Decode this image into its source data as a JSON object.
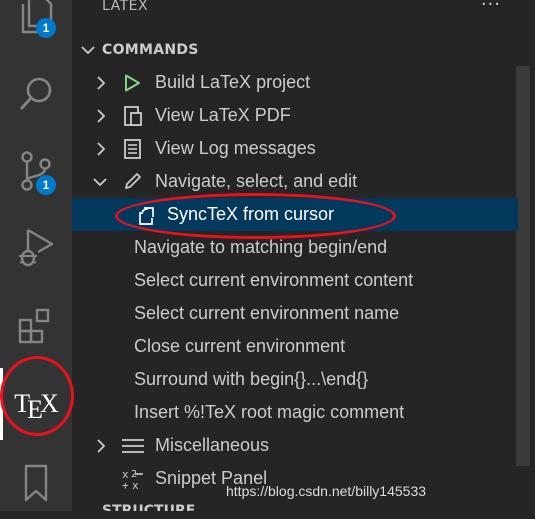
{
  "activity_bar": {
    "explorer_badge": "1",
    "source_control_badge": "1",
    "tex_logo_t": "T",
    "tex_logo_e": "E",
    "tex_logo_x": "X",
    "active_item": "tex"
  },
  "panel": {
    "title": "LATEX",
    "more_actions": "···",
    "section_title": "COMMANDS",
    "items": [
      {
        "label": "Build LaTeX project",
        "icon": "play-icon",
        "collapsed": true
      },
      {
        "label": "View LaTeX PDF",
        "icon": "pdf-preview-icon",
        "collapsed": true
      },
      {
        "label": "View Log messages",
        "icon": "log-icon",
        "collapsed": true
      },
      {
        "label": "Navigate, select, and edit",
        "icon": "edit-icon",
        "expanded": true
      },
      {
        "label": "SyncTeX from cursor",
        "icon": "sync-icon",
        "selected": true
      },
      {
        "label": "Navigate to matching begin/end"
      },
      {
        "label": "Select current environment content"
      },
      {
        "label": "Select current environment name"
      },
      {
        "label": "Close current environment"
      },
      {
        "label": "Surround with begin{}...\\end{}"
      },
      {
        "label": "Insert %!TeX root magic comment"
      },
      {
        "label": "Miscellaneous",
        "icon": "list-icon",
        "collapsed": true
      },
      {
        "label": "Snippet Panel",
        "icon": "snippet-icon"
      }
    ],
    "next_section_title": "STRUCTURE"
  },
  "watermark": "https://blog.csdn.net/billy145533",
  "colors": {
    "activity_bg": "#333333",
    "panel_bg": "#252526",
    "selection_bg": "#04395e",
    "badge": "#007acc",
    "annotation_ring": "#e8121d",
    "play_green": "#89d185"
  }
}
